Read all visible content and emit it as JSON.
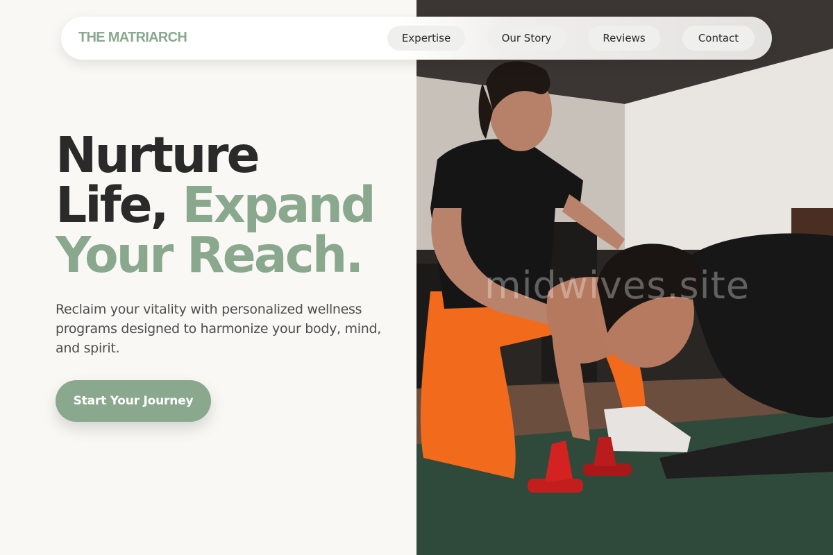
{
  "nav": {
    "brand": "THE MATRIARCH",
    "links": [
      {
        "label": "Expertise"
      },
      {
        "label": "Our Story"
      },
      {
        "label": "Reviews"
      },
      {
        "label": "Contact"
      }
    ]
  },
  "hero": {
    "headline_line1": "Nurture",
    "headline_line2_a": "Life",
    "headline_comma": ",",
    "headline_line2_b": "Expand",
    "headline_line3": "Your Reach",
    "headline_period": ".",
    "subtitle": "Reclaim your vitality with personalized wellness programs designed to harmonize your body, mind, and spirit.",
    "cta_label": "Start Your Journey"
  },
  "photo": {
    "watermark": "midwives.site"
  },
  "colors": {
    "accent": "#8aa88e",
    "background": "#f9f8f4",
    "text": "#2a2a2a"
  }
}
